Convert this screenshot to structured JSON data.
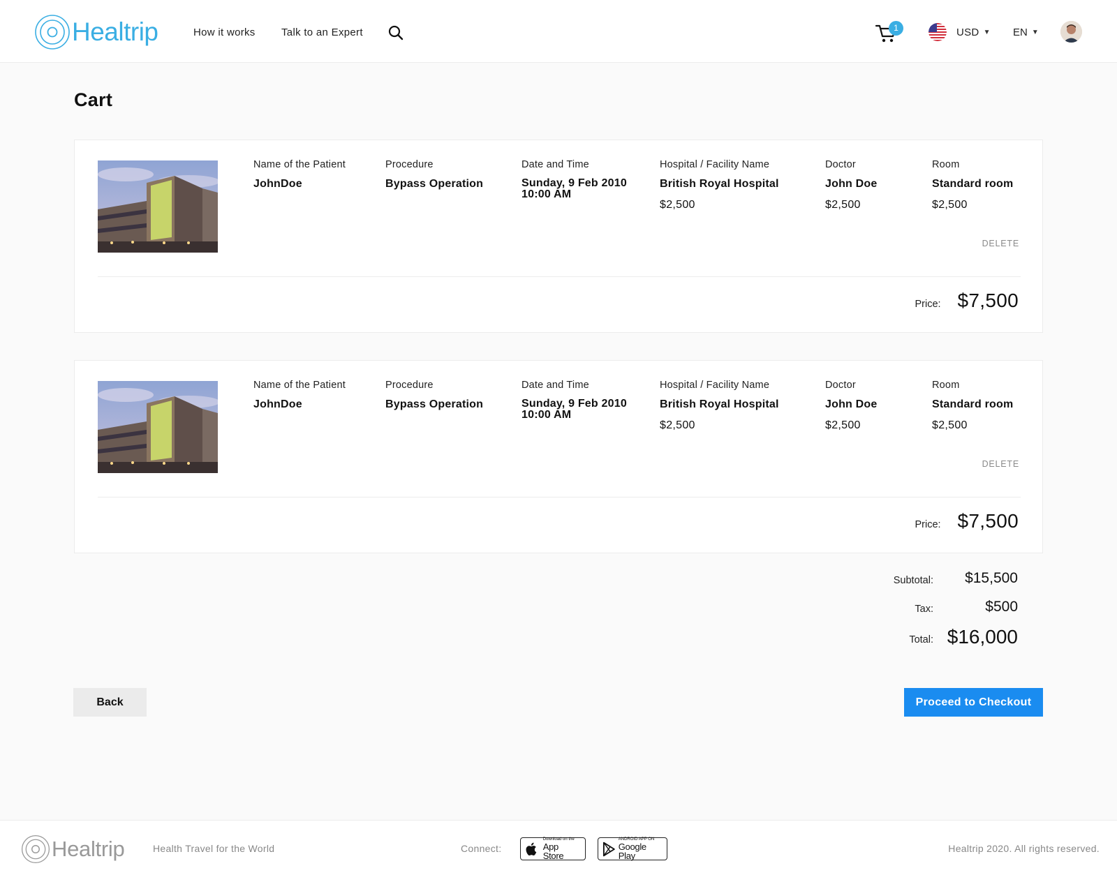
{
  "header": {
    "logo_text": "Healtrip",
    "nav": {
      "how_it_works": "How it works",
      "talk_to_expert": "Talk to an Expert"
    },
    "cart_count": "1",
    "currency": "USD",
    "language": "EN",
    "accent_color": "#3aaee3"
  },
  "page": {
    "title": "Cart"
  },
  "cart": {
    "labels": {
      "patient": "Name of the Patient",
      "procedure": "Procedure",
      "datetime": "Date and Time",
      "hospital": "Hospital / Facility Name",
      "doctor": "Doctor",
      "room": "Room",
      "delete": "DELETE",
      "price": "Price:"
    },
    "items": [
      {
        "patient": "JohnDoe",
        "procedure": "Bypass Operation",
        "date": "Sunday, 9 Feb 2010",
        "time": "10:00 AM",
        "hospital": "British Royal Hospital",
        "hospital_price": "$2,500",
        "doctor": "John Doe",
        "doctor_price": "$2,500",
        "room": "Standard room",
        "room_price": "$2,500",
        "price": "$7,500"
      },
      {
        "patient": "JohnDoe",
        "procedure": "Bypass Operation",
        "date": "Sunday, 9 Feb 2010",
        "time": "10:00 AM",
        "hospital": "British Royal Hospital",
        "hospital_price": "$2,500",
        "doctor": "John Doe",
        "doctor_price": "$2,500",
        "room": "Standard room",
        "room_price": "$2,500",
        "price": "$7,500"
      }
    ]
  },
  "totals": {
    "subtotal_label": "Subtotal:",
    "subtotal": "$15,500",
    "tax_label": "Tax:",
    "tax": "$500",
    "total_label": "Total:",
    "total": "$16,000"
  },
  "actions": {
    "back": "Back",
    "checkout": "Proceed to Checkout",
    "checkout_color": "#1a8cf0"
  },
  "footer": {
    "logo_text": "Healtrip",
    "tagline": "Health Travel for the World",
    "connect": "Connect:",
    "app_store_small": "Download on the",
    "app_store_big": "App Store",
    "google_play_small": "ANDROID APP ON",
    "google_play_big": "Google Play",
    "copyright": "Healtrip 2020. All rights reserved."
  }
}
